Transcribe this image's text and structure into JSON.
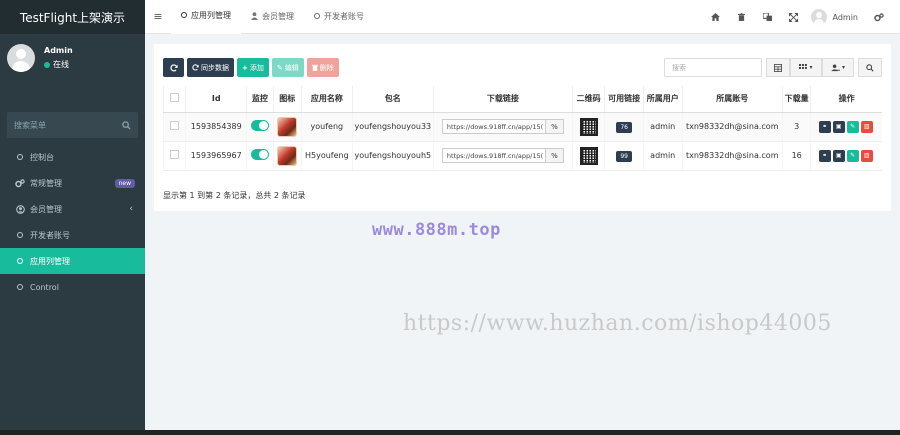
{
  "app": {
    "brand": "TestFlight上架演示"
  },
  "sidebar": {
    "user": {
      "name": "Admin",
      "status": "在线"
    },
    "search_placeholder": "搜索菜单",
    "items": [
      {
        "label": "控制台",
        "icon": "circle-o-icon"
      },
      {
        "label": "常规管理",
        "icon": "cogs-icon",
        "badge": "new"
      },
      {
        "label": "会员管理",
        "icon": "user-circle-icon"
      },
      {
        "label": "开发者账号",
        "icon": "circle-o-icon"
      },
      {
        "label": "应用列管理",
        "icon": "circle-o-icon",
        "active": true
      },
      {
        "label": "Control",
        "icon": "circle-o-icon"
      }
    ]
  },
  "navbar": {
    "tabs": [
      {
        "label": "应用列管理",
        "active": true
      },
      {
        "label": "会员管理"
      },
      {
        "label": "开发者账号"
      }
    ],
    "user_name": "Admin"
  },
  "toolbar": {
    "sync_label": "同步数据",
    "add_label": "添加",
    "edit_label": "编辑",
    "delete_label": "删除",
    "search_placeholder": "搜索"
  },
  "table": {
    "headers": [
      "",
      "Id",
      "监控",
      "图标",
      "应用名称",
      "包名",
      "下载链接",
      "二维码",
      "可用链接",
      "所属用户",
      "所属账号",
      "下载量",
      "操作"
    ],
    "rows": [
      {
        "id": "1593854389",
        "name": "youfeng",
        "package": "youfengshouyou33",
        "link": "https://dows.918ff.cn/app/15(",
        "available": "76",
        "user": "admin",
        "account": "txn98332dh@sina.com",
        "downloads": "3"
      },
      {
        "id": "1593965967",
        "name": "H5youfeng",
        "package": "youfengshouyouh5",
        "link": "https://dows.918ff.cn/app/15(",
        "available": "99",
        "user": "admin",
        "account": "txn98332dh@sina.com",
        "downloads": "16"
      }
    ]
  },
  "pagination": {
    "text": "显示第 1 到第 2 条记录，总共 2 条记录"
  },
  "watermarks": {
    "primary": "www.888m.top",
    "secondary": "https://www.huzhan.com/ishop44005"
  },
  "colors": {
    "accent": "#18bc9c",
    "sidebar": "#2c3b41",
    "dark": "#2c3e50",
    "danger": "#e74c3c",
    "badge": "#605ca8"
  }
}
